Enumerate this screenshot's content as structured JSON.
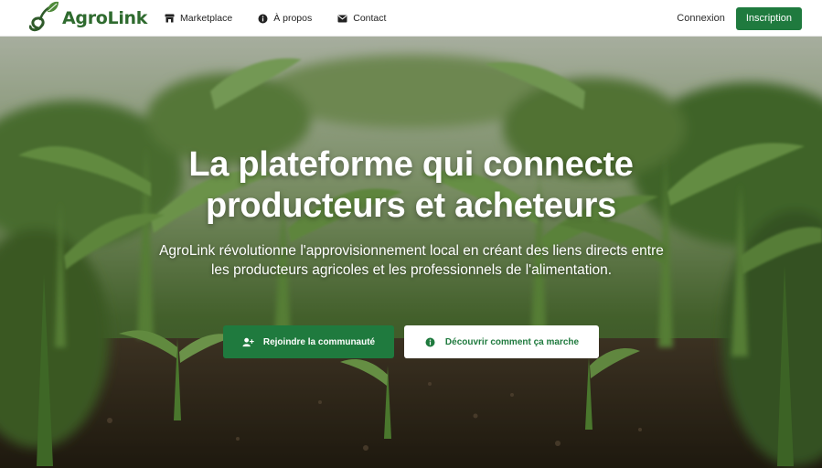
{
  "brand": {
    "name": "AgroLink",
    "color": "#2f6b2f"
  },
  "nav": {
    "items": [
      {
        "label": "Marketplace",
        "icon": "store-icon"
      },
      {
        "label": "À propos",
        "icon": "info-icon"
      },
      {
        "label": "Contact",
        "icon": "envelope-icon"
      }
    ],
    "login_label": "Connexion",
    "signup_label": "Inscription"
  },
  "hero": {
    "title_line1": "La plateforme qui connecte",
    "title_line2": "producteurs et acheteurs",
    "subtitle": "AgroLink révolutionne l'approvisionnement local en créant des liens directs entre les producteurs agricoles et les professionnels de l'alimentation.",
    "primary_cta": {
      "label": "Rejoindre la communauté",
      "icon": "user-plus-icon"
    },
    "secondary_cta": {
      "label": "Découvrir comment ça marche",
      "icon": "info-circle-icon"
    },
    "background": "corn-seedlings-photo"
  },
  "colors": {
    "accent": "#1f7a3e",
    "text_dark": "#222222",
    "white": "#ffffff"
  }
}
